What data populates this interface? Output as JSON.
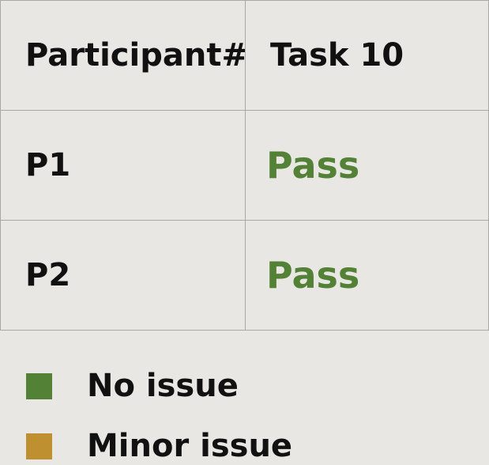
{
  "table": {
    "headers": [
      "Participant#",
      "Task 10"
    ],
    "rows": [
      {
        "participant": "P1",
        "status": "Pass"
      },
      {
        "participant": "P2",
        "status": "Pass"
      }
    ]
  },
  "legend": [
    {
      "label": "No issue",
      "color": "#538135"
    },
    {
      "label": "Minor issue",
      "color": "#bf9030"
    }
  ],
  "colors": {
    "pass": "#538135",
    "background": "#e8e7e4",
    "border": "#a9a8a5"
  }
}
